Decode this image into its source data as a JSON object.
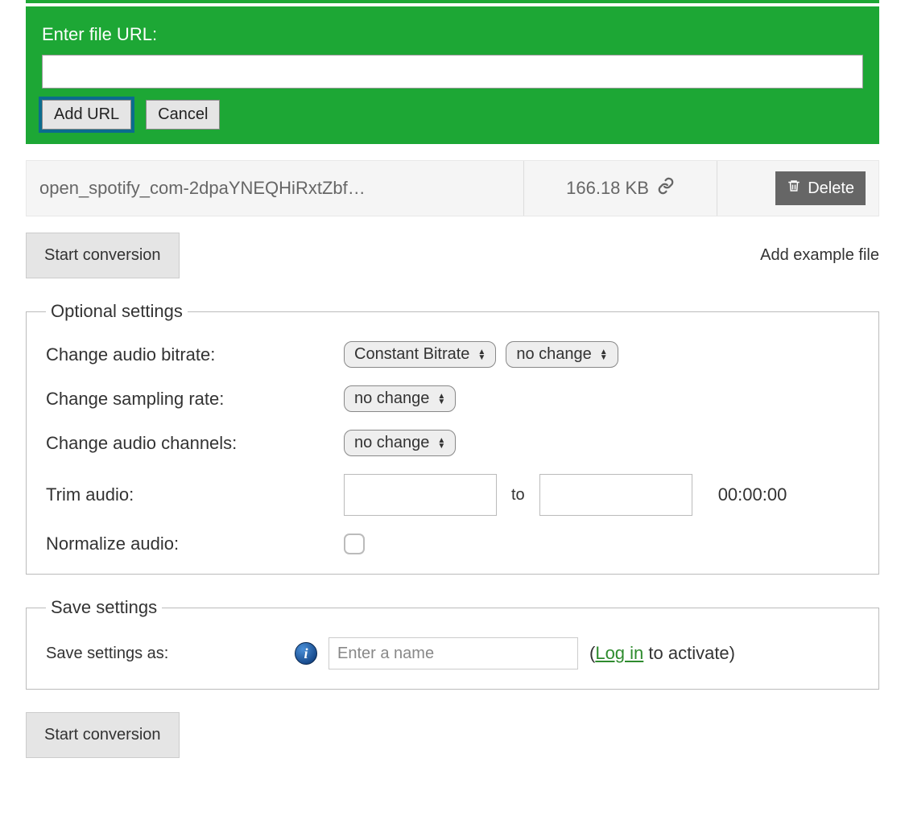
{
  "url_panel": {
    "label": "Enter file URL:",
    "add_btn": "Add URL",
    "cancel_btn": "Cancel"
  },
  "file": {
    "name": "open_spotify_com-2dpaYNEQHiRxtZbf…",
    "size": "166.18 KB",
    "delete_btn": "Delete"
  },
  "start_btn": "Start conversion",
  "example_link": "Add example file",
  "optional_legend": "Optional settings",
  "settings": {
    "bitrate_label": "Change audio bitrate:",
    "bitrate_mode": "Constant Bitrate",
    "bitrate_value": "no change",
    "sampling_label": "Change sampling rate:",
    "sampling_value": "no change",
    "channels_label": "Change audio channels:",
    "channels_value": "no change",
    "trim_label": "Trim audio:",
    "trim_to": "to",
    "trim_duration": "00:00:00",
    "normalize_label": "Normalize audio:"
  },
  "save_legend": "Save settings",
  "save": {
    "label": "Save settings as:",
    "placeholder": "Enter a name",
    "paren_open": "(",
    "login": "Log in",
    "activate": " to activate)"
  }
}
